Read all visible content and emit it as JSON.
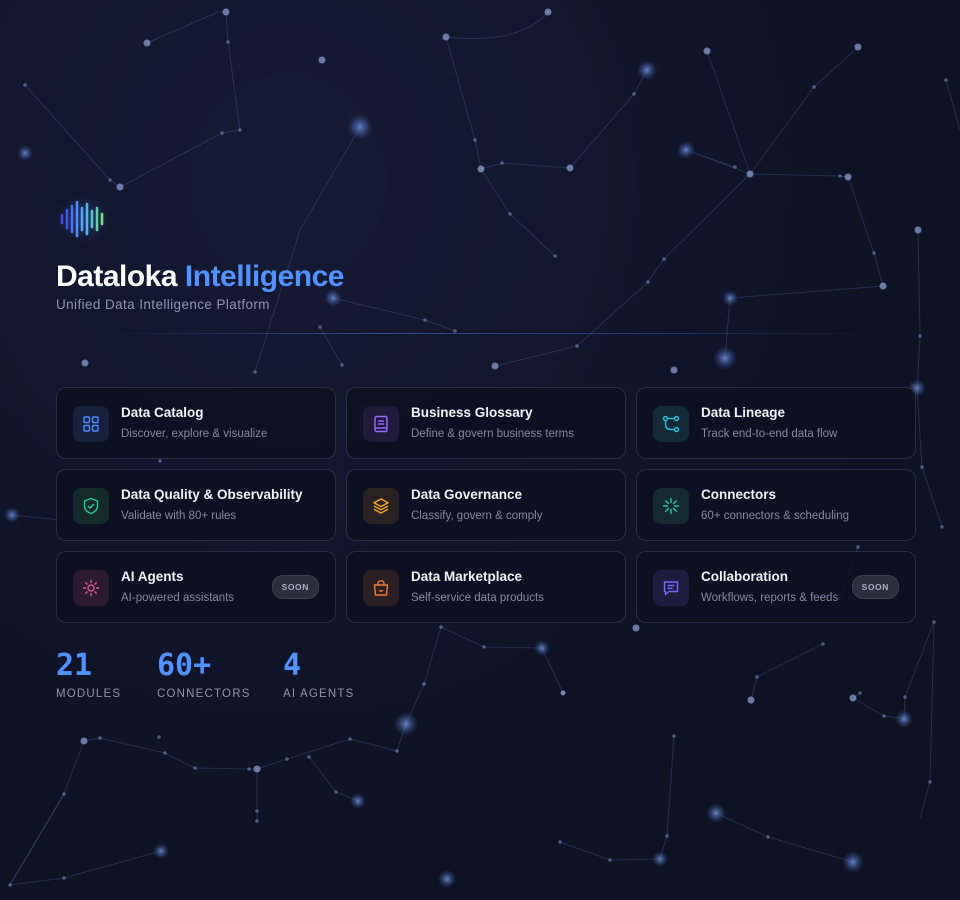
{
  "brand": {
    "name": "Dataloka",
    "accent": "Intelligence",
    "subtitle": "Unified Data Intelligence Platform",
    "logo_icon": "waveform-bars-icon"
  },
  "colors": {
    "background": "#0f1326",
    "accent": "#4f93ff",
    "card_border": "#2b3050"
  },
  "modules": [
    {
      "title": "Data Catalog",
      "desc": "Discover, explore & visualize",
      "icon": "grid-icon",
      "color": "#4f8cff",
      "bg": "#17223f"
    },
    {
      "title": "Business Glossary",
      "desc": "Define & govern business terms",
      "icon": "book-icon",
      "color": "#9b6bff",
      "bg": "#201b3d"
    },
    {
      "title": "Data Lineage",
      "desc": "Track end-to-end data flow",
      "icon": "lineage-icon",
      "color": "#27c2e0",
      "bg": "#132a38"
    },
    {
      "title": "Data Quality & Observability",
      "desc": "Validate with 80+ rules",
      "icon": "shield-check-icon",
      "color": "#2ecc8f",
      "bg": "#132b2a"
    },
    {
      "title": "Data Governance",
      "desc": "Classify, govern & comply",
      "icon": "layers-icon",
      "color": "#f5a623",
      "bg": "#2a2222"
    },
    {
      "title": "Connectors",
      "desc": "60+ connectors & scheduling",
      "icon": "spark-icon",
      "color": "#2bc4b0",
      "bg": "#142a31"
    },
    {
      "title": "AI Agents",
      "desc": "AI-powered assistants",
      "icon": "sun-gear-icon",
      "color": "#e8529a",
      "bg": "#2b1a30",
      "badge": "SOON"
    },
    {
      "title": "Data Marketplace",
      "desc": "Self-service data products",
      "icon": "shopping-bag-icon",
      "color": "#f07a2e",
      "bg": "#2b1f24"
    },
    {
      "title": "Collaboration",
      "desc": "Workflows, reports & feeds",
      "icon": "chat-icon",
      "color": "#6f6bff",
      "bg": "#1d1d40",
      "badge": "SOON"
    }
  ],
  "stats": [
    {
      "value": "21",
      "label": "MODULES"
    },
    {
      "value": "60+",
      "label": "CONNECTORS"
    },
    {
      "value": "4",
      "label": "AI AGENTS"
    }
  ]
}
